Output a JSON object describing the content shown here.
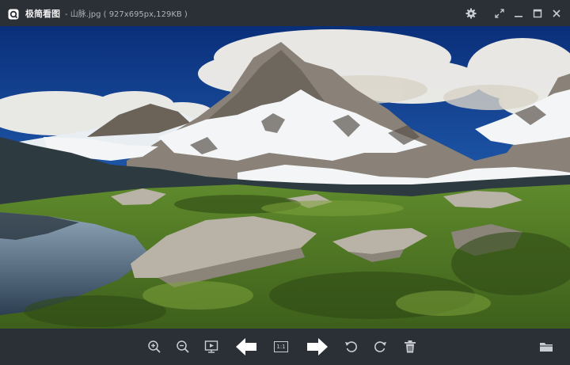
{
  "titlebar": {
    "app_name": "极简看图",
    "file_info": "- 山脉.jpg ( 927x695px,129KB )"
  },
  "icons": {
    "app": "viewer-logo-icon",
    "settings": "gear-icon",
    "fullscreen": "fullscreen-icon",
    "minimize": "minimize-icon",
    "maximize": "maximize-icon",
    "close": "close-icon"
  },
  "toolbar": {
    "actual_size_label": "1:1"
  },
  "image": {
    "subject": "mountain landscape"
  }
}
